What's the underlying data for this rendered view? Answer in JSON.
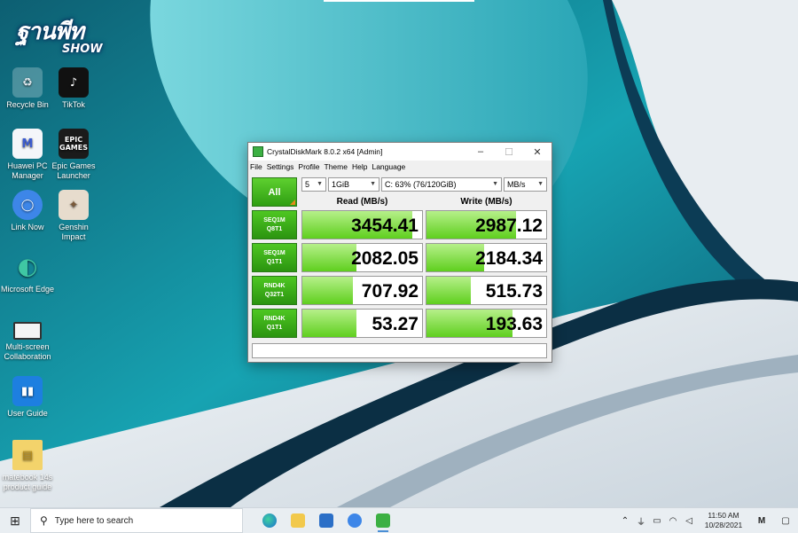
{
  "desktop": {
    "watermark": {
      "line1": "ฐานพีท",
      "line2": "SHOW"
    },
    "icons": [
      {
        "label": "Recycle Bin",
        "icon": "recycle-bin-icon"
      },
      {
        "label": "TikTok",
        "icon": "tiktok-icon"
      },
      {
        "label": "Huawei PC Manager",
        "icon": "huawei-pc-manager-icon"
      },
      {
        "label": "Epic Games Launcher",
        "icon": "epic-games-icon"
      },
      {
        "label": "Link Now",
        "icon": "link-now-icon"
      },
      {
        "label": "Genshin Impact",
        "icon": "genshin-impact-icon"
      },
      {
        "label": "Microsoft Edge",
        "icon": "edge-icon"
      },
      {
        "label": "Multi-screen Collaboration",
        "icon": "multi-screen-icon"
      },
      {
        "label": "User Guide",
        "icon": "user-guide-icon"
      },
      {
        "label": "matebook 14s product guide",
        "icon": "folder-icon"
      }
    ],
    "epic_text": "EPIC\nGAMES"
  },
  "window": {
    "title": "CrystalDiskMark 8.0.2 x64 [Admin]",
    "menu": [
      "File",
      "Settings",
      "Profile",
      "Theme",
      "Help",
      "Language"
    ],
    "all_label": "All",
    "count": "5",
    "size": "1GiB",
    "drive": "C: 63% (76/120GiB)",
    "unit": "MB/s",
    "read_header": "Read (MB/s)",
    "write_header": "Write (MB/s)",
    "rows": [
      {
        "l1": "SEQ1M",
        "l2": "Q8T1",
        "read": "3454.41",
        "write": "2987.12",
        "read_fill": 0.92,
        "write_fill": 0.75
      },
      {
        "l1": "SEQ1M",
        "l2": "Q1T1",
        "read": "2082.05",
        "write": "2184.34",
        "read_fill": 0.45,
        "write_fill": 0.48
      },
      {
        "l1": "RND4K",
        "l2": "Q32T1",
        "read": "707.92",
        "write": "515.73",
        "read_fill": 0.42,
        "write_fill": 0.37
      },
      {
        "l1": "RND4K",
        "l2": "Q1T1",
        "read": "53.27",
        "write": "193.63",
        "read_fill": 0.45,
        "write_fill": 0.72
      }
    ]
  },
  "taskbar": {
    "search_placeholder": "Type here to search",
    "time": "11:50 AM",
    "date": "10/28/2021",
    "colors": {
      "bg": "#e9eef2",
      "accent": "#4a8fd6"
    }
  }
}
